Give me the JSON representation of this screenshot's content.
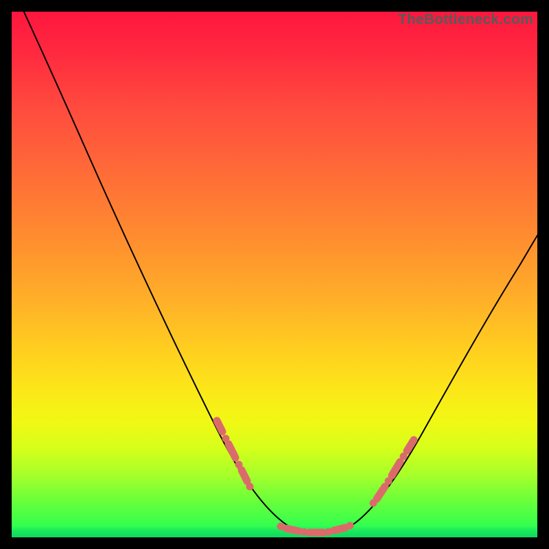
{
  "watermark": "TheBottleneck.com",
  "colors": {
    "background": "#000000",
    "gradient_top": "#ff163e",
    "gradient_mid": "#ffd41e",
    "gradient_bottom": "#1bff57",
    "curve": "#000000",
    "markers": "#db6b6b"
  },
  "chart_data": {
    "type": "line",
    "title": "",
    "xlabel": "",
    "ylabel": "",
    "xlim": [
      0,
      100
    ],
    "ylim": [
      0,
      100
    ],
    "series": [
      {
        "name": "bottleneck-curve",
        "x": [
          0,
          5,
          10,
          15,
          20,
          25,
          30,
          35,
          40,
          45,
          50,
          53,
          56,
          58,
          60,
          62,
          65,
          70,
          75,
          80,
          85,
          90,
          95,
          100
        ],
        "y": [
          104,
          96,
          87,
          78,
          69,
          60,
          51,
          42,
          33,
          24,
          14,
          8,
          3,
          1,
          0,
          1,
          4,
          12,
          21,
          30,
          38,
          45,
          52,
          58
        ]
      }
    ],
    "markers": {
      "left_cluster": {
        "x_range": [
          38,
          44
        ],
        "y_range": [
          16,
          28
        ]
      },
      "valley_cluster": {
        "x_range": [
          51,
          63
        ],
        "y_range": [
          0,
          4
        ]
      },
      "right_cluster": {
        "x_range": [
          66,
          72
        ],
        "y_range": [
          8,
          18
        ]
      }
    },
    "annotations": []
  }
}
